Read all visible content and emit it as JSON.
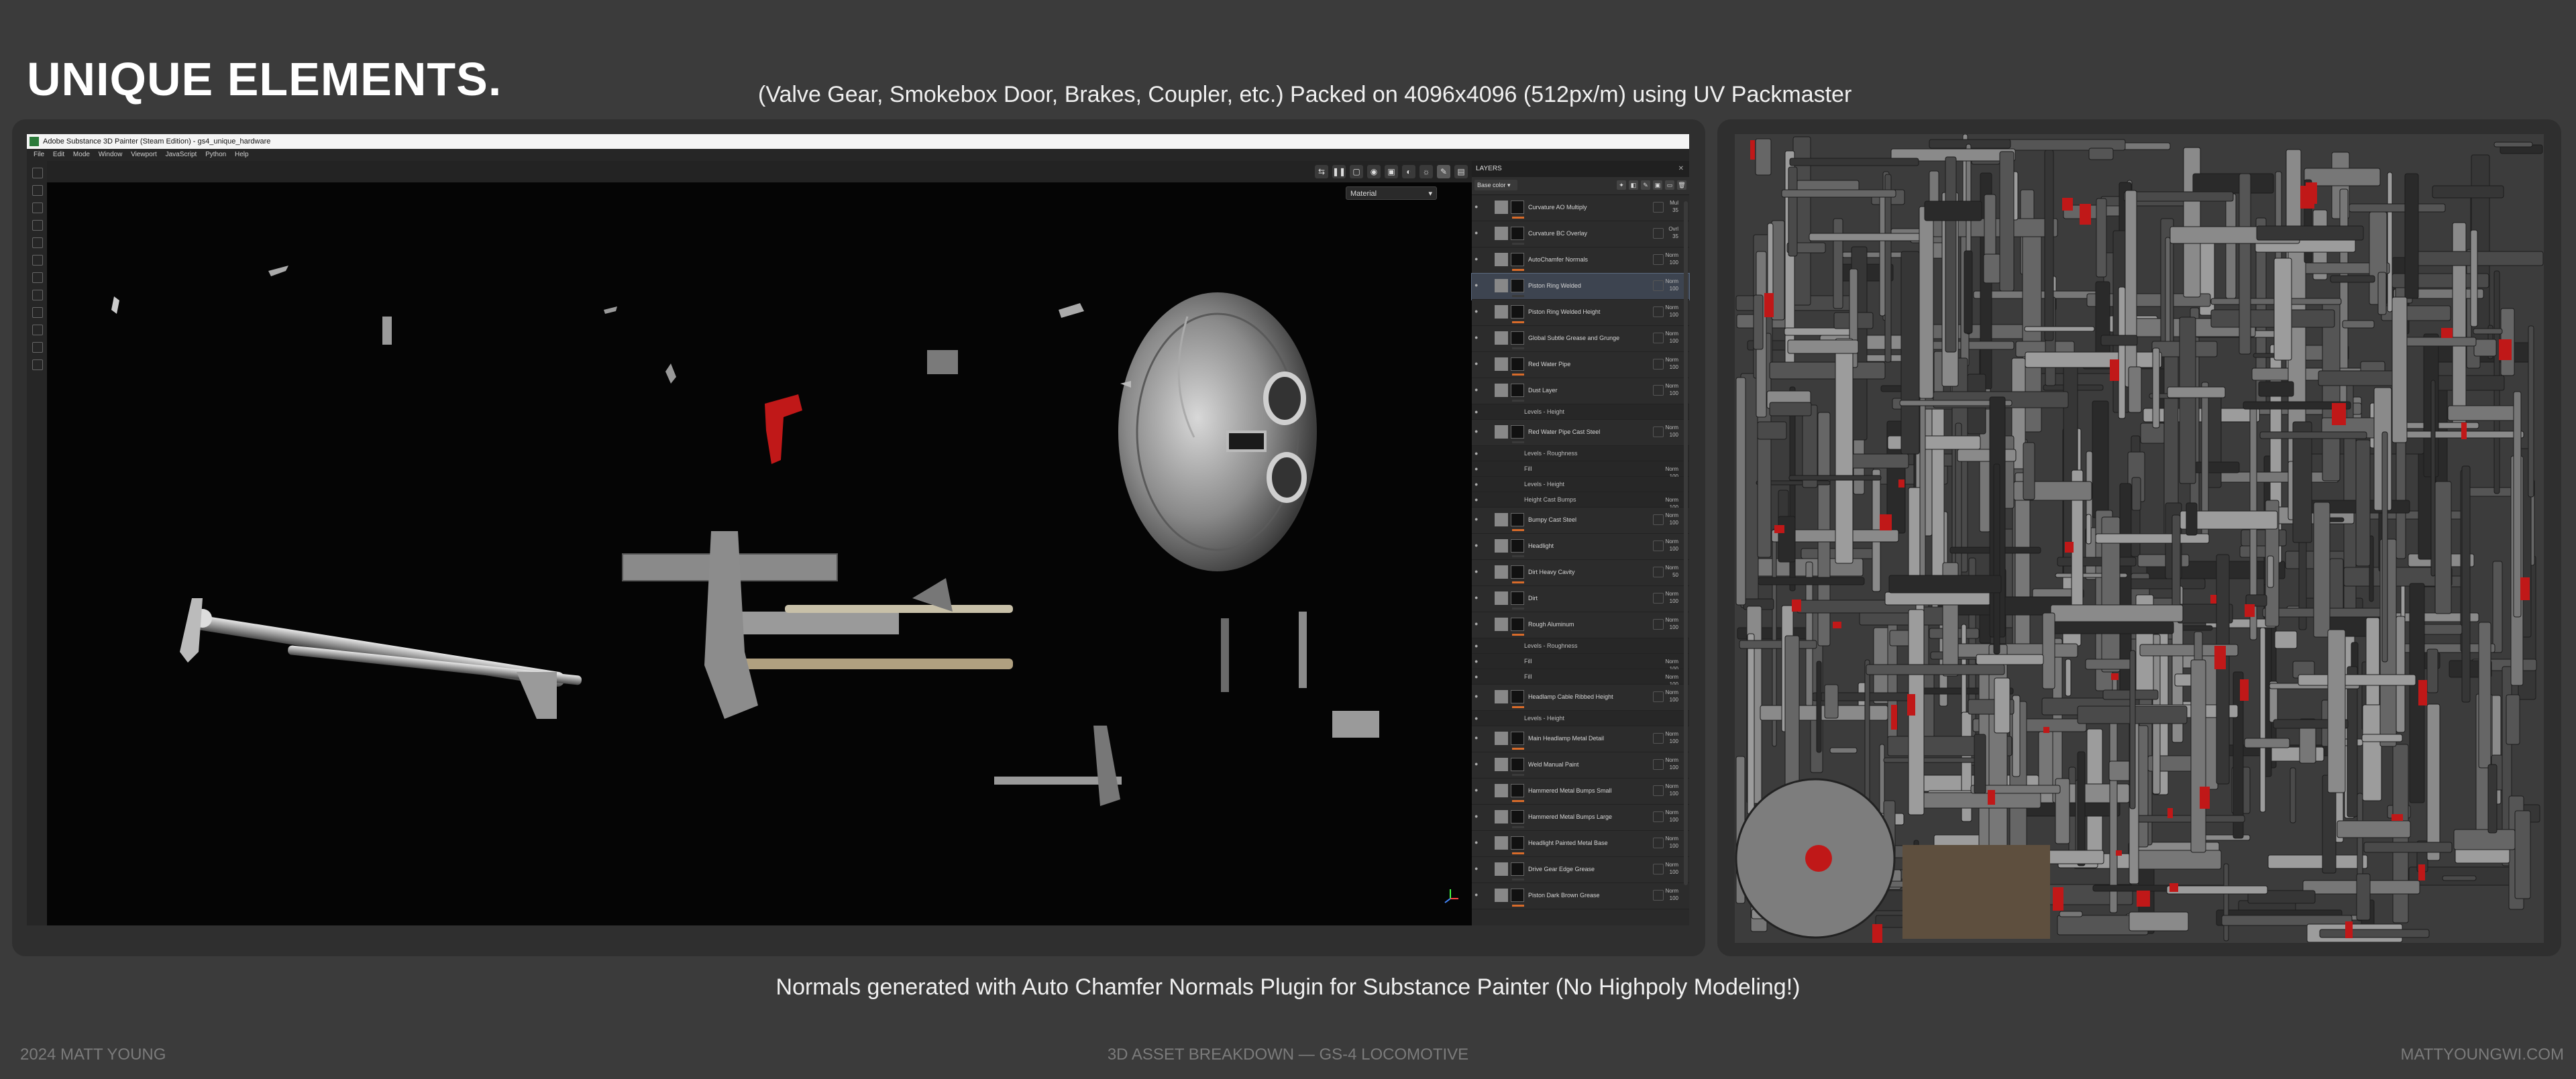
{
  "title": "UNIQUE ELEMENTS.",
  "subtitle": "(Valve Gear, Smokebox Door, Brakes, Coupler, etc.) Packed on 4096x4096 (512px/m) using UV Packmaster",
  "caption": "Normals generated with Auto Chamfer Normals Plugin for Substance Painter (No Highpoly Modeling!)",
  "footer": {
    "left": "2024 MATT YOUNG",
    "center": "3D ASSET BREAKDOWN — GS-4 LOCOMOTIVE",
    "right": "MATTYOUNGWI.COM"
  },
  "app": {
    "window_title": "Adobe Substance 3D Painter (Steam Edition) - gs4_unique_hardware",
    "menu": [
      "File",
      "Edit",
      "Mode",
      "Window",
      "Viewport",
      "JavaScript",
      "Python",
      "Help"
    ],
    "viewport_mode": "Material",
    "layers_panel": {
      "header": "LAYERS",
      "channel": "Base color",
      "layers": [
        {
          "name": "Curvature AO Multiply",
          "blend": "Mul",
          "opacity": "35",
          "type": "layer"
        },
        {
          "name": "Curvature BC Overlay",
          "blend": "Ovrl",
          "opacity": "35",
          "type": "layer"
        },
        {
          "name": "AutoChamfer Normals",
          "blend": "Norm",
          "opacity": "100",
          "type": "layer"
        },
        {
          "name": "Piston Ring Welded",
          "blend": "Norm",
          "opacity": "100",
          "type": "layer",
          "selected": true
        },
        {
          "name": "Piston Ring Welded Height",
          "blend": "Norm",
          "opacity": "100",
          "type": "layer"
        },
        {
          "name": "Global Subtle Grease and Grunge",
          "blend": "Norm",
          "opacity": "100",
          "type": "layer"
        },
        {
          "name": "Red Water Pipe",
          "blend": "Norm",
          "opacity": "100",
          "type": "layer"
        },
        {
          "name": "Dust Layer",
          "blend": "Norm",
          "opacity": "100",
          "type": "layer"
        },
        {
          "name": "Levels - Height",
          "type": "effect"
        },
        {
          "name": "Red Water Pipe Cast Steel",
          "blend": "Norm",
          "opacity": "100",
          "type": "layer"
        },
        {
          "name": "Levels - Roughness",
          "type": "effect"
        },
        {
          "name": "Fill",
          "blend": "Norm",
          "opacity": "100",
          "type": "effect"
        },
        {
          "name": "Levels - Height",
          "type": "effect"
        },
        {
          "name": "Height Cast Bumps",
          "blend": "Norm",
          "opacity": "100",
          "type": "effect"
        },
        {
          "name": "Bumpy Cast Steel",
          "blend": "Norm",
          "opacity": "100",
          "type": "layer"
        },
        {
          "name": "Headlight",
          "blend": "Norm",
          "opacity": "100",
          "type": "layer"
        },
        {
          "name": "Dirt Heavy Cavity",
          "blend": "Norm",
          "opacity": "50",
          "type": "layer"
        },
        {
          "name": "Dirt",
          "blend": "Norm",
          "opacity": "100",
          "type": "layer"
        },
        {
          "name": "Rough Aluminum",
          "blend": "Norm",
          "opacity": "100",
          "type": "layer"
        },
        {
          "name": "Levels - Roughness",
          "type": "effect"
        },
        {
          "name": "Fill",
          "blend": "Norm",
          "opacity": "100",
          "type": "effect"
        },
        {
          "name": "Fill",
          "blend": "Norm",
          "opacity": "100",
          "type": "effect"
        },
        {
          "name": "Headlamp Cable Ribbed Height",
          "blend": "Norm",
          "opacity": "100",
          "type": "layer"
        },
        {
          "name": "Levels - Height",
          "type": "effect"
        },
        {
          "name": "Main Headlamp Metal Detail",
          "blend": "Norm",
          "opacity": "100",
          "type": "layer"
        },
        {
          "name": "Weld Manual Paint",
          "blend": "Norm",
          "opacity": "100",
          "type": "layer"
        },
        {
          "name": "Hammered Metal Bumps Small",
          "blend": "Norm",
          "opacity": "100",
          "type": "layer"
        },
        {
          "name": "Hammered Metal Bumps Large",
          "blend": "Norm",
          "opacity": "100",
          "type": "layer"
        },
        {
          "name": "Headlight Painted Metal Base",
          "blend": "Norm",
          "opacity": "100",
          "type": "layer"
        },
        {
          "name": "Drive Gear Edge Grease",
          "blend": "Norm",
          "opacity": "100",
          "type": "layer"
        },
        {
          "name": "Piston Dark Brown Grease",
          "blend": "Norm",
          "opacity": "100",
          "type": "layer"
        }
      ]
    }
  },
  "colors": {
    "background": "#3b3b3b",
    "panel": "#2f2f2f",
    "accent_red": "#c01818"
  }
}
